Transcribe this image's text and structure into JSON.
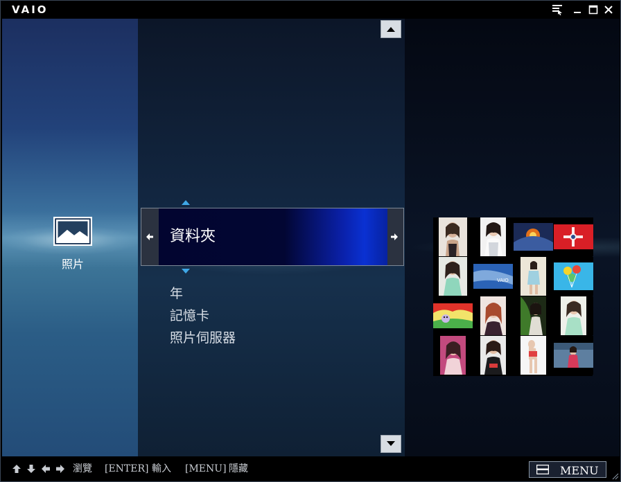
{
  "brand": "VAIO",
  "category": {
    "label": "照片",
    "icon": "photo-icon"
  },
  "menu": {
    "selected": "資料夾",
    "items": [
      "年",
      "記憶卡",
      "照片伺服器"
    ]
  },
  "footer": {
    "browse_label": "瀏覽",
    "enter_key": "[ENTER]",
    "enter_label": "輸入",
    "menu_key": "[MENU]",
    "menu_label": "隱藏",
    "menu_button": "MENU"
  },
  "window_controls": [
    "display-mode-icon",
    "minimize-icon",
    "maximize-icon",
    "close-icon"
  ],
  "thumbnails": [
    {
      "name": "portrait-woman"
    },
    {
      "name": "portrait-woman"
    },
    {
      "name": "abstract-orange"
    },
    {
      "name": "red-pattern"
    },
    {
      "name": "portrait-woman"
    },
    {
      "name": "vaio-wallpaper"
    },
    {
      "name": "portrait-woman"
    },
    {
      "name": "balloons"
    },
    {
      "name": "cartoon-scene"
    },
    {
      "name": "portrait-woman"
    },
    {
      "name": "portrait-leaf"
    },
    {
      "name": "portrait-woman"
    },
    {
      "name": "portrait-woman"
    },
    {
      "name": "portrait-woman"
    },
    {
      "name": "portrait-woman"
    },
    {
      "name": "portrait-woman"
    }
  ],
  "colors": {
    "selection_highlight": "#0a31d2",
    "arrow_accent": "#3fa7e6"
  }
}
